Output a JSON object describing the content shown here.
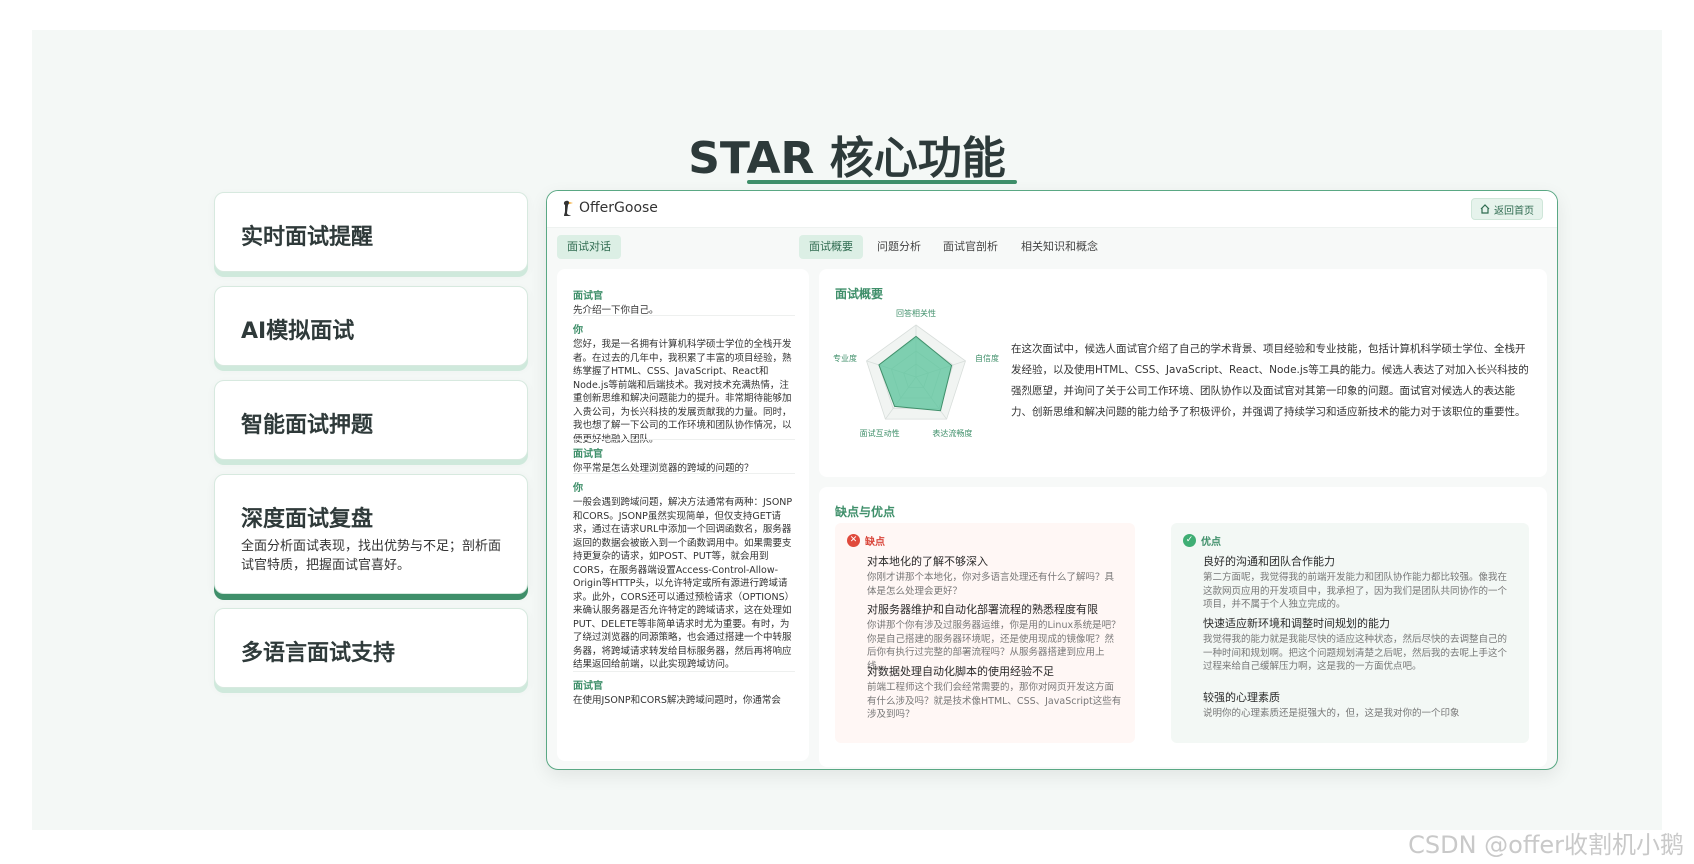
{
  "page": {
    "title": "STAR 核心功能",
    "watermark": "CSDN @offer收割机小鹅"
  },
  "features": [
    {
      "title": "实时面试提醒"
    },
    {
      "title": "AI模拟面试"
    },
    {
      "title": "智能面试押题"
    },
    {
      "title": "深度面试复盘",
      "desc": "全面分析面试表现，找出优势与不足；剖析面试官特质，把握面试官喜好。"
    },
    {
      "title": "多语言面试支持"
    }
  ],
  "app": {
    "logo": "OfferGoose",
    "home_button": "返回首页",
    "left_tab": "面试对话",
    "tabs": [
      "面试概要",
      "问题分析",
      "面试官剖析",
      "相关知识和概念"
    ],
    "chat": [
      {
        "who": "面试官",
        "text": "先介绍一下你自己。"
      },
      {
        "who": "你",
        "text": "您好，我是一名拥有计算机科学硕士学位的全栈开发者。在过去的几年中，我积累了丰富的项目经验，熟练掌握了HTML、CSS、JavaScript、React和Node.js等前端和后端技术。我对技术充满热情，注重创新思维和解决问题能力的提升。非常期待能够加入贵公司，为长兴科技的发展贡献我的力量。同时，我也想了解一下公司的工作环境和团队协作情况，以便更好地融入团队。"
      },
      {
        "who": "面试官",
        "text": "你平常是怎么处理浏览器的跨域的问题的？"
      },
      {
        "who": "你",
        "text": "一般会遇到跨域问题，解决方法通常有两种：JSONP和CORS。JSONP虽然实现简单，但仅支持GET请求，通过在请求URL中添加一个回调函数名，服务器返回的数据会被嵌入到一个函数调用中。如果需要支持更复杂的请求，如POST、PUT等，就会用到CORS，在服务器端设置Access-Control-Allow-Origin等HTTP头，以允许特定或所有源进行跨域请求。此外，CORS还可以通过预检请求（OPTIONS）来确认服务器是否允许特定的跨域请求，这在处理如PUT、DELETE等非简单请求时尤为重要。有时，为了绕过浏览器的同源策略，也会通过搭建一个中转服务器，将跨域请求转发给目标服务器，然后再将响应结果返回给前端，以此实现跨域访问。"
      },
      {
        "who": "面试官",
        "text": "在使用JSONP和CORS解决跨域问题时，你通常会"
      }
    ],
    "overview": {
      "heading": "面试概要",
      "radar_labels": [
        "回答相关性",
        "自信度",
        "表达流畅度",
        "面试互动性",
        "专业度"
      ],
      "radar_values": [
        0.78,
        0.72,
        0.8,
        0.7,
        0.75
      ],
      "text": "在这次面试中，候选人面试官介绍了自己的学术背景、项目经验和专业技能，包括计算机科学硕士学位、全栈开发经验，以及使用HTML、CSS、JavaScript、React、Node.js等工具的能力。候选人表达了对加入长兴科技的强烈愿望，并询问了关于公司工作环境、团队协作以及面试官对其第一印象的问题。面试官对候选人的表达能力、创新思维和解决问题的能力给予了积极评价，并强调了持续学习和适应新技术的能力对于该职位的重要性。"
    },
    "pros_cons": {
      "heading": "缺点与优点",
      "cons_label": "缺点",
      "pros_label": "优点",
      "cons": [
        {
          "title": "对本地化的了解不够深入",
          "quote": "你刚才讲那个本地化，你对多语言处理还有什么了解吗？具体是怎么处理会更好？"
        },
        {
          "title": "对服务器维护和自动化部署流程的熟悉程度有限",
          "quote": "你讲那个你有涉及过服务器运维，你是用的Linux系统是吧？你是自己搭建的服务器环境呢，还是使用现成的镜像呢？然后你有执行过完整的部署流程吗？从服务器搭建到应用上线。"
        },
        {
          "title": "对数据处理自动化脚本的使用经验不足",
          "quote": "前端工程师这个我们会经常需要的，那你对网页开发这方面有什么涉及吗？就是技术像HTML、CSS、JavaScript这些有涉及到吗？"
        }
      ],
      "pros": [
        {
          "title": "良好的沟通和团队合作能力",
          "quote": "第二方面呢，我觉得我的前端开发能力和团队协作能力都比较强。像我在这款网页应用的开发项目中，我承担了，因为我们是团队共同协作的一个项目，并不属于个人独立完成的。"
        },
        {
          "title": "快速适应新环境和调整时间规划的能力",
          "quote": "我觉得我的能力就是我能尽快的适应这种状态，然后尽快的去调整自己的一种时间和规划啊。把这个问题规划清楚之后呢，然后我的去呢上手这个过程来给自己缓解压力啊，这是我的一方面优点吧。"
        },
        {
          "title": "较强的心理素质",
          "quote": "说明你的心理素质还是挺强大的，但，这是我对你的一个印象"
        }
      ]
    }
  }
}
